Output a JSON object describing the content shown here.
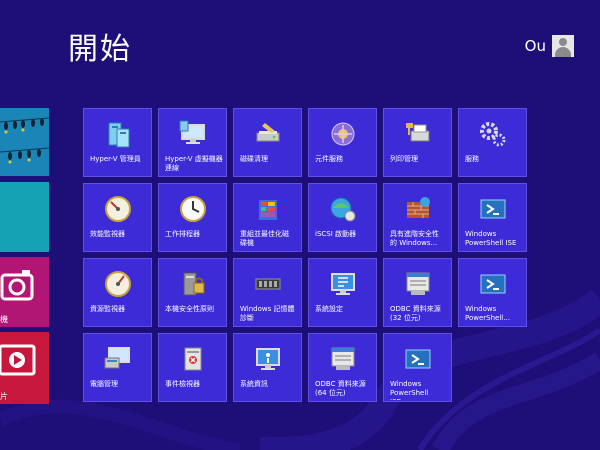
{
  "screen": {
    "title": "開始"
  },
  "user": {
    "name": "Ou"
  },
  "left_tiles": {
    "camera_label": "機",
    "video_label": "片"
  },
  "tiles": [
    {
      "label": "Hyper-V 管理員",
      "icon": "hyperv-manager-icon"
    },
    {
      "label": "Hyper-V 虛擬機器\n連線",
      "icon": "vm-connection-icon"
    },
    {
      "label": "磁碟清理",
      "icon": "disk-cleanup-icon"
    },
    {
      "label": "元件服務",
      "icon": "component-services-icon"
    },
    {
      "label": "列印管理",
      "icon": "print-management-icon"
    },
    {
      "label": "服務",
      "icon": "services-gear-icon"
    },
    {
      "label": "效能監視器",
      "icon": "performance-monitor-icon"
    },
    {
      "label": "工作排程器",
      "icon": "task-scheduler-clock-icon"
    },
    {
      "label": "重組並最佳化磁\n碟機",
      "icon": "defragment-drives-icon"
    },
    {
      "label": "iSCSI 啟動器",
      "icon": "iscsi-initiator-icon"
    },
    {
      "label": "具有進階安全性\n的 Windows...",
      "icon": "firewall-icon"
    },
    {
      "label": "Windows\nPowerShell ISE",
      "icon": "powershell-ise-icon"
    },
    {
      "label": "資源監視器",
      "icon": "resource-monitor-icon"
    },
    {
      "label": "本機安全性原則",
      "icon": "local-security-policy-icon"
    },
    {
      "label": "Windows 記憶體\n診斷",
      "icon": "memory-diagnostic-icon"
    },
    {
      "label": "系統設定",
      "icon": "system-configuration-icon"
    },
    {
      "label": "ODBC 資料來源\n(32 位元)",
      "icon": "odbc-32-icon"
    },
    {
      "label": "Windows\nPowerShell...",
      "icon": "powershell-icon"
    },
    {
      "label": "電腦管理",
      "icon": "computer-management-icon"
    },
    {
      "label": "事件檢視器",
      "icon": "event-viewer-icon"
    },
    {
      "label": "系統資訊",
      "icon": "system-information-icon"
    },
    {
      "label": "ODBC 資料來源\n(64 位元)",
      "icon": "odbc-64-icon"
    },
    {
      "label": "Windows\nPowerShell ISE...",
      "icon": "powershell-ise-x86-icon"
    }
  ],
  "colors": {
    "background": "#1e0e78",
    "tile": "#3c2bd7",
    "tile_border": "#5f51e4"
  }
}
